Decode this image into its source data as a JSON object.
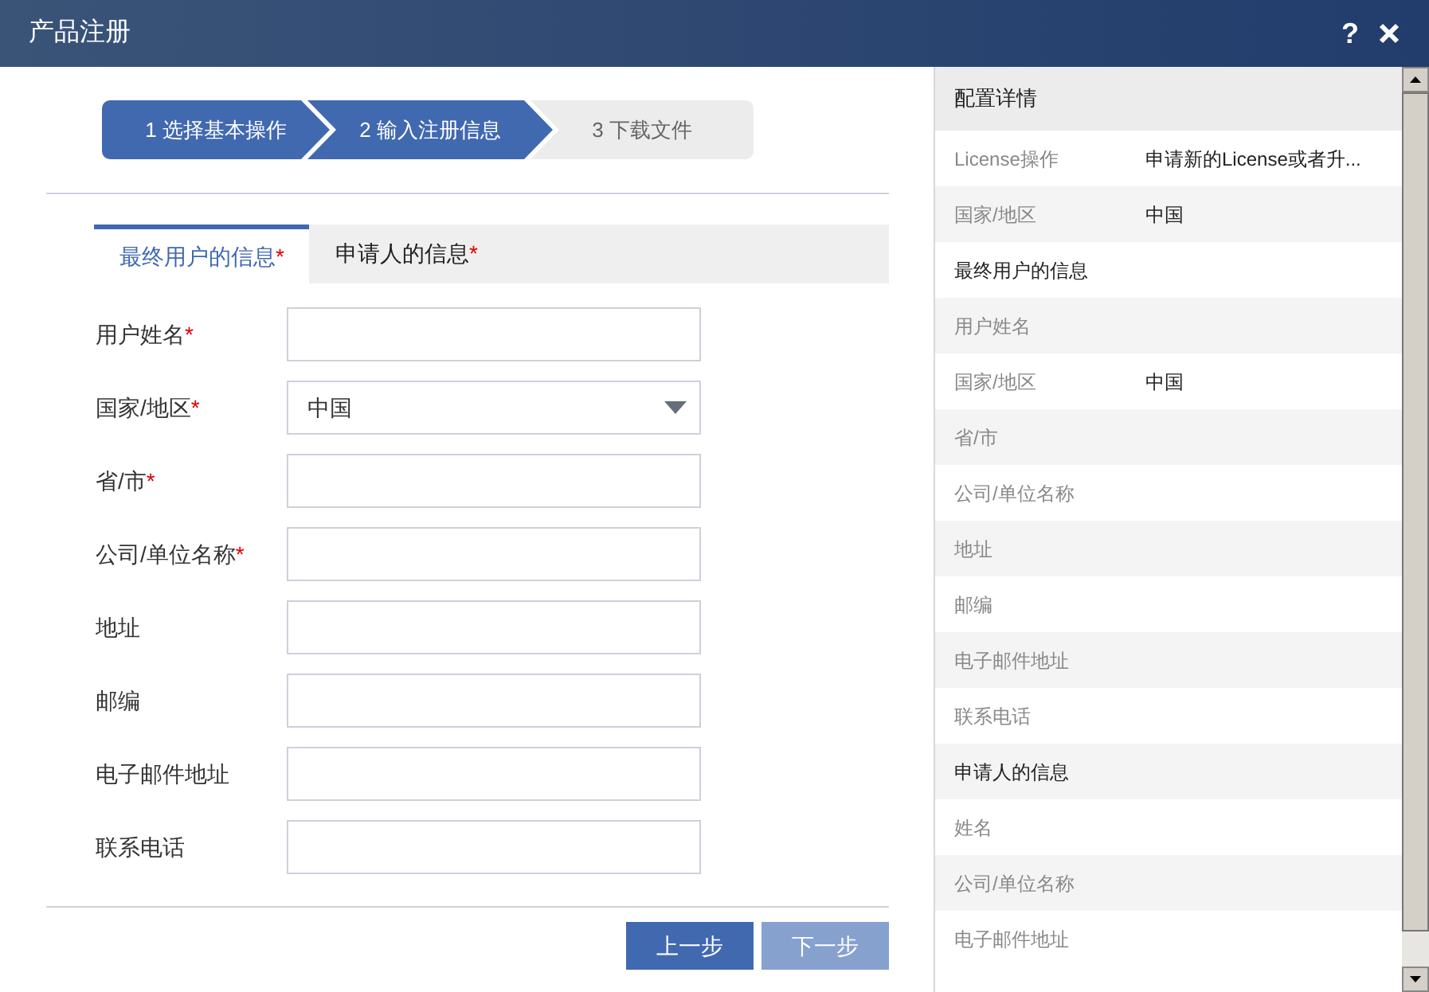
{
  "window": {
    "title": "产品注册",
    "help": "?"
  },
  "steps": [
    {
      "label": "1 选择基本操作",
      "active": true
    },
    {
      "label": "2 输入注册信息",
      "active": true
    },
    {
      "label": "3 下载文件",
      "active": false
    }
  ],
  "tabs": [
    {
      "label": "最终用户的信息",
      "required_mark": "*",
      "selected": true
    },
    {
      "label": "申请人的信息",
      "required_mark": "*",
      "selected": false
    }
  ],
  "form": [
    {
      "label": "用户姓名",
      "required_mark": "*",
      "kind": "text"
    },
    {
      "label": "国家/地区",
      "required_mark": "*",
      "kind": "select",
      "value": "中国"
    },
    {
      "label": "省/市",
      "required_mark": "*",
      "kind": "text"
    },
    {
      "label": "公司/单位名称",
      "required_mark": "*",
      "kind": "text"
    },
    {
      "label": "地址",
      "kind": "text"
    },
    {
      "label": "邮编",
      "kind": "text"
    },
    {
      "label": "电子邮件地址",
      "kind": "text"
    },
    {
      "label": "联系电话",
      "kind": "text"
    }
  ],
  "buttons": [
    {
      "label": "上一步",
      "disabled": false
    },
    {
      "label": "下一步",
      "disabled": true
    }
  ],
  "details": {
    "title": "配置详情",
    "rows": [
      {
        "kind": "field",
        "label": "License操作",
        "value": "申请新的License或者升..."
      },
      {
        "kind": "field",
        "label": "国家/地区",
        "value": "中国"
      },
      {
        "kind": "section",
        "label": "最终用户的信息"
      },
      {
        "kind": "field",
        "label": "用户姓名"
      },
      {
        "kind": "field",
        "label": "国家/地区",
        "value": "中国"
      },
      {
        "kind": "field",
        "label": "省/市"
      },
      {
        "kind": "field",
        "label": "公司/单位名称"
      },
      {
        "kind": "field",
        "label": "地址"
      },
      {
        "kind": "field",
        "label": "邮编"
      },
      {
        "kind": "field",
        "label": "电子邮件地址"
      },
      {
        "kind": "field",
        "label": "联系电话"
      },
      {
        "kind": "section",
        "label": "申请人的信息"
      },
      {
        "kind": "field",
        "label": "姓名"
      },
      {
        "kind": "field",
        "label": "公司/单位名称"
      },
      {
        "kind": "field",
        "label": "电子邮件地址"
      }
    ]
  }
}
